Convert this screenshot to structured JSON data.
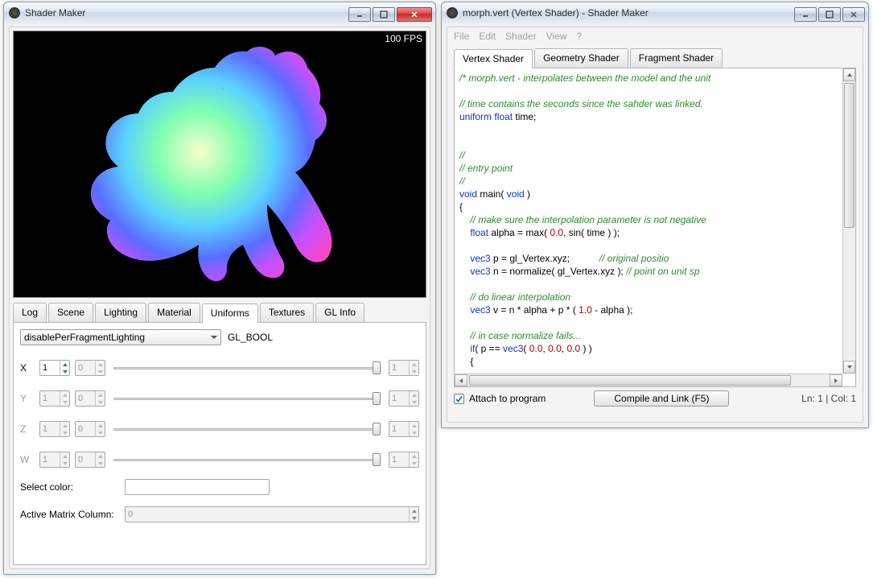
{
  "left_window": {
    "title": "Shader Maker",
    "fps_label": "100 FPS",
    "tabs": [
      "Log",
      "Scene",
      "Lighting",
      "Material",
      "Uniforms",
      "Textures",
      "GL Info"
    ],
    "active_tab_index": 4,
    "uniforms": {
      "combo_value": "disablePerFragmentLighting",
      "type_label": "GL_BOOL",
      "axes": [
        {
          "name": "X",
          "left": "1",
          "mid": "0",
          "right": "1",
          "enabled": true
        },
        {
          "name": "Y",
          "left": "1",
          "mid": "0",
          "right": "1",
          "enabled": false
        },
        {
          "name": "Z",
          "left": "1",
          "mid": "0",
          "right": "1",
          "enabled": false
        },
        {
          "name": "W",
          "left": "1",
          "mid": "0",
          "right": "1",
          "enabled": false
        }
      ],
      "select_color_label": "Select color:",
      "active_matrix_label": "Active Matrix Column:",
      "active_matrix_value": "0"
    }
  },
  "right_window": {
    "title": "morph.vert (Vertex Shader)  - Shader Maker",
    "menus": [
      "File",
      "Edit",
      "Shader",
      "View",
      "?"
    ],
    "tabs": [
      "Vertex Shader",
      "Geometry Shader",
      "Fragment Shader"
    ],
    "active_tab_index": 0,
    "attach_label": "Attach to program",
    "attach_checked": true,
    "compile_button": "Compile and Link (F5)",
    "status": "Ln: 1 | Col: 1",
    "code_lines": [
      {
        "t": "comm",
        "s": "/* morph.vert - interpolates between the model and the unit"
      },
      {
        "t": "",
        "s": ""
      },
      {
        "t": "comm",
        "s": "// time contains the seconds since the sahder was linked."
      },
      {
        "t": "mix",
        "parts": [
          [
            "kw",
            "uniform"
          ],
          [
            "",
            " "
          ],
          [
            "type",
            "float"
          ],
          [
            "",
            " time;"
          ]
        ]
      },
      {
        "t": "",
        "s": ""
      },
      {
        "t": "",
        "s": ""
      },
      {
        "t": "comm",
        "s": "//"
      },
      {
        "t": "comm",
        "s": "// entry point"
      },
      {
        "t": "comm",
        "s": "//"
      },
      {
        "t": "mix",
        "parts": [
          [
            "type",
            "void"
          ],
          [
            "",
            " main( "
          ],
          [
            "type",
            "void"
          ],
          [
            "",
            " )"
          ]
        ]
      },
      {
        "t": "",
        "s": "{"
      },
      {
        "t": "comm",
        "s": "    // make sure the interpolation parameter is not negative"
      },
      {
        "t": "mix",
        "parts": [
          [
            "",
            "    "
          ],
          [
            "type",
            "float"
          ],
          [
            "",
            " alpha = max( "
          ],
          [
            "num",
            "0.0"
          ],
          [
            "",
            ", sin( time ) );"
          ]
        ]
      },
      {
        "t": "",
        "s": ""
      },
      {
        "t": "mix",
        "parts": [
          [
            "",
            "    "
          ],
          [
            "type",
            "vec3"
          ],
          [
            "",
            " p = gl_Vertex.xyz;           "
          ],
          [
            "comm",
            "// original positio"
          ]
        ]
      },
      {
        "t": "mix",
        "parts": [
          [
            "",
            "    "
          ],
          [
            "type",
            "vec3"
          ],
          [
            "",
            " n = normalize( gl_Vertex.xyz ); "
          ],
          [
            "comm",
            "// point on unit sp"
          ]
        ]
      },
      {
        "t": "",
        "s": ""
      },
      {
        "t": "comm",
        "s": "    // do linear interpolation"
      },
      {
        "t": "mix",
        "parts": [
          [
            "",
            "    "
          ],
          [
            "type",
            "vec3"
          ],
          [
            "",
            " v = n * alpha + p * ( "
          ],
          [
            "num",
            "1.0"
          ],
          [
            "",
            " - alpha );"
          ]
        ]
      },
      {
        "t": "",
        "s": ""
      },
      {
        "t": "comm",
        "s": "    // in case normalize fails..."
      },
      {
        "t": "mix",
        "parts": [
          [
            "",
            "    "
          ],
          [
            "kw",
            "if"
          ],
          [
            "",
            "( p == "
          ],
          [
            "type",
            "vec3"
          ],
          [
            "",
            "( "
          ],
          [
            "num",
            "0.0"
          ],
          [
            "",
            ", "
          ],
          [
            "num",
            "0.0"
          ],
          [
            "",
            ", "
          ],
          [
            "num",
            "0.0"
          ],
          [
            "",
            " ) )"
          ]
        ]
      },
      {
        "t": "",
        "s": "    {"
      }
    ]
  }
}
